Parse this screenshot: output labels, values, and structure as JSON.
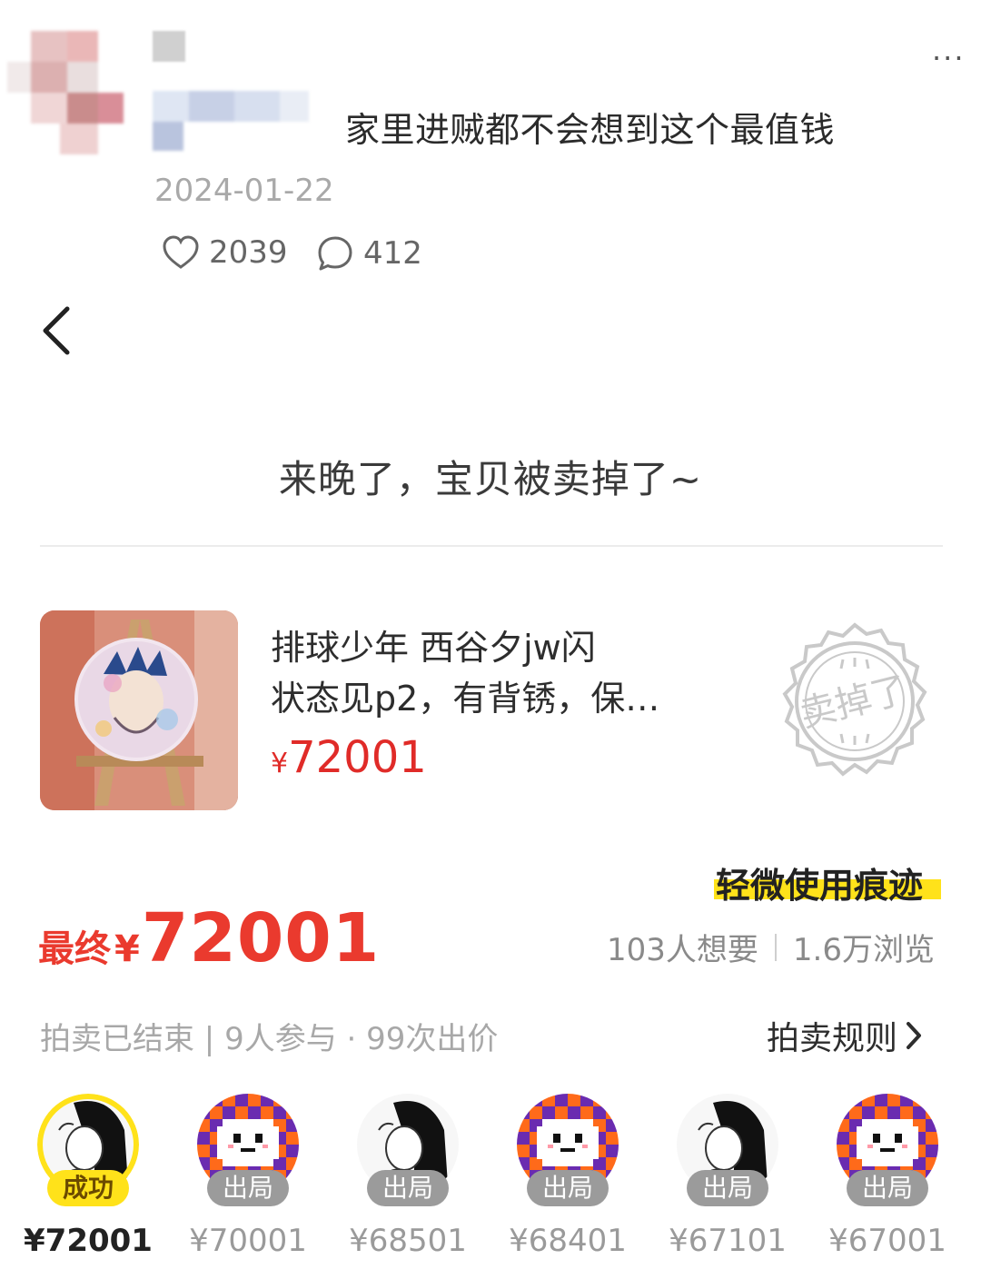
{
  "post": {
    "title": "家里进贼都不会想到这个最值钱",
    "date": "2024-01-22",
    "likes": "2039",
    "comments": "412",
    "more": "···"
  },
  "listing": {
    "sold_message": "来晚了，宝贝被卖掉了~",
    "item_line1": "排球少年 西谷夕jw闪",
    "item_line2": "状态见p2，有背锈，保…",
    "currency": "¥",
    "item_price": "72001",
    "stamp_text": "卖掉了",
    "wear_tag": "轻微使用痕迹",
    "final_label": "最终",
    "final_price": "72001",
    "want_count": "103人想要",
    "view_count": "1.6万浏览",
    "auction_status": "拍卖已结束 | 9人参与 · 99次出价",
    "auction_rules": "拍卖规则"
  },
  "bidders": [
    {
      "status": "成功",
      "price": "¥72001",
      "avatar": "girl-drawing"
    },
    {
      "status": "出局",
      "price": "¥70001",
      "avatar": "pixel-ghost"
    },
    {
      "status": "出局",
      "price": "¥68501",
      "avatar": "girl-drawing"
    },
    {
      "status": "出局",
      "price": "¥68401",
      "avatar": "pixel-ghost"
    },
    {
      "status": "出局",
      "price": "¥67101",
      "avatar": "girl-drawing"
    },
    {
      "status": "出局",
      "price": "¥67001",
      "avatar": "pixel-ghost"
    }
  ],
  "colors": {
    "price_red": "#e02b28",
    "tag_yellow": "#ffe21a",
    "muted_gray": "#a8a8a8"
  }
}
